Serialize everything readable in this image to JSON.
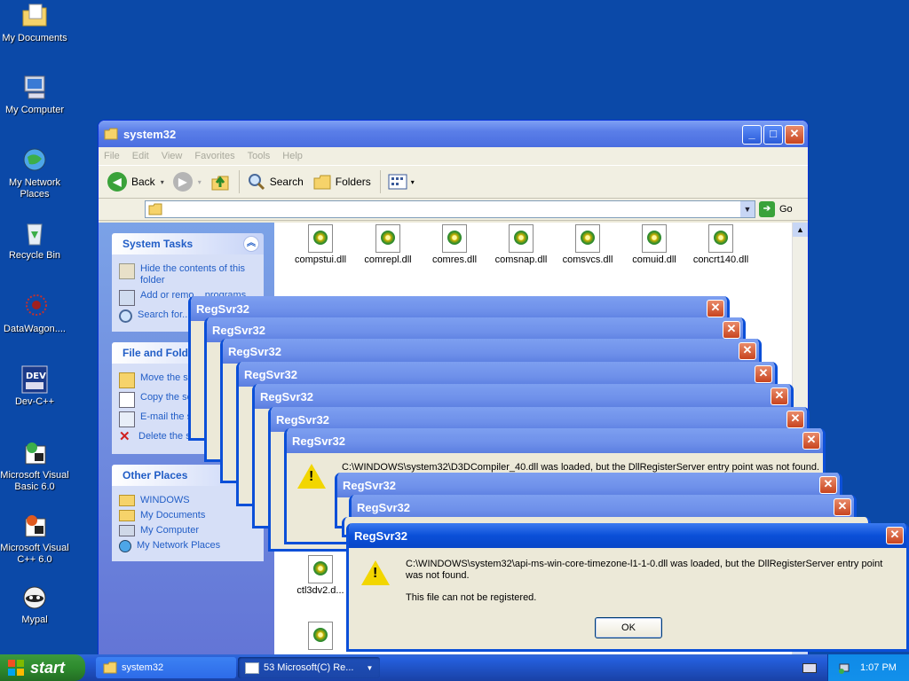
{
  "desktop": {
    "icons": [
      {
        "label": "My Documents",
        "icon": "folder-documents-icon"
      },
      {
        "label": "My Computer",
        "icon": "computer-icon"
      },
      {
        "label": "My Network Places",
        "icon": "network-icon"
      },
      {
        "label": "Recycle Bin",
        "icon": "recycle-bin-icon"
      },
      {
        "label": "DataWagon....",
        "icon": "datawagon-icon"
      },
      {
        "label": "Dev-C++",
        "icon": "devcpp-icon"
      },
      {
        "label": "Microsoft Visual Basic 6.0",
        "icon": "vb6-icon"
      },
      {
        "label": "Microsoft Visual C++ 6.0",
        "icon": "vcpp6-icon"
      },
      {
        "label": "Mypal",
        "icon": "mypal-icon"
      }
    ]
  },
  "explorer": {
    "title": "system32",
    "menu": [
      "File",
      "Edit",
      "View",
      "Favorites",
      "Tools",
      "Help"
    ],
    "toolbar": {
      "back": "Back",
      "search": "Search",
      "folders": "Folders"
    },
    "go_label": "Go",
    "address": "",
    "system_tasks": {
      "title": "System Tasks",
      "items": [
        "Hide the contents of this folder",
        "Add or remo... programs",
        "Search for... folders"
      ]
    },
    "file_folder_tasks": {
      "title": "File and Folde...",
      "items": [
        "Move the s... items",
        "Copy the selec... items",
        "E-mail the selected items",
        "Delete the selected items"
      ]
    },
    "other_places": {
      "title": "Other Places",
      "items": [
        "WINDOWS",
        "My Documents",
        "My Computer",
        "My Network Places"
      ]
    },
    "files_row1": [
      "compstui.dll",
      "comrepl.dll",
      "comres.dll",
      "comsnap.dll",
      "comsvcs.dll",
      "comuid.dll",
      "concrt140.dll"
    ],
    "file_partial": "ctl3dv2.d..."
  },
  "dialogs": {
    "title": "RegSvr32",
    "msg_back": "C:\\WINDOWS\\system32\\D3DCompiler_40.dll was loaded, but the DllRegisterServer entry point was not found.",
    "msg_front": "C:\\WINDOWS\\system32\\api-ms-win-core-timezone-l1-1-0.dll was loaded, but the DllRegisterServer entry point was not found.",
    "msg_front_2": "This file can not be registered.",
    "ok_label": "OK"
  },
  "taskbar": {
    "start": "start",
    "items": [
      "system32",
      "53 Microsoft(C) Re..."
    ],
    "clock": "1:07 PM"
  },
  "colors": {
    "desktop": "#0b49a8",
    "titlebar_active": "#0a4fd8",
    "start": "#2e8b2e"
  }
}
